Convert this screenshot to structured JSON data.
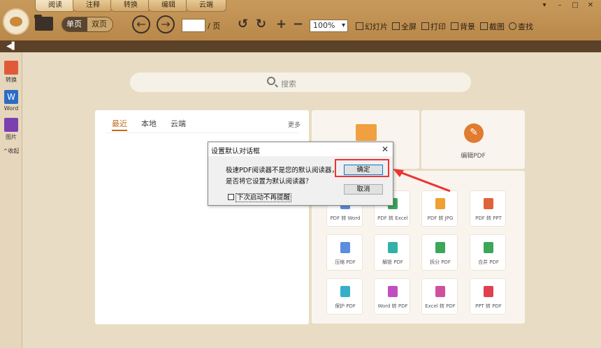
{
  "tabs": [
    "阅读",
    "注释",
    "转换",
    "编辑",
    "云端"
  ],
  "active_tab": "阅读",
  "window_controls": [
    "▾",
    "–",
    "□",
    "✕"
  ],
  "toolbar": {
    "single_page": "单页",
    "double_page": "双页",
    "page_suffix": "/ 页",
    "zoom_value": "100%",
    "slideshow": "幻灯片",
    "fullscreen": "全屏",
    "print": "打印",
    "background": "背景",
    "screenshot": "截图",
    "find": "查找"
  },
  "sidebar": {
    "items": [
      {
        "label": "转换",
        "icon": "pdf-convert-icon",
        "color": "#e05a3a"
      },
      {
        "label": "Word",
        "icon": "word-icon",
        "color": "#2b6cc4"
      },
      {
        "label": "图片",
        "icon": "image-icon",
        "color": "#7b3fb0"
      }
    ],
    "collapse_label": "收起"
  },
  "search": {
    "placeholder": "搜索"
  },
  "recent_panel": {
    "tabs": [
      "最近",
      "本地",
      "云端"
    ],
    "active": "最近",
    "more": "更多"
  },
  "cards": {
    "open_label": "",
    "edit_label": "编辑PDF"
  },
  "tools": [
    {
      "label": "PDF 转 Word",
      "color": "#5b8de0"
    },
    {
      "label": "PDF 转 Excel",
      "color": "#3ca65a"
    },
    {
      "label": "PDF 转 JPG",
      "color": "#f0a030"
    },
    {
      "label": "PDF 转 PPT",
      "color": "#e0613a"
    },
    {
      "label": "压缩 PDF",
      "color": "#5b8de0"
    },
    {
      "label": "解锁 PDF",
      "color": "#35b0a8"
    },
    {
      "label": "拆分 PDF",
      "color": "#3ca65a"
    },
    {
      "label": "合并 PDF",
      "color": "#3ca65a"
    },
    {
      "label": "保护 PDF",
      "color": "#35b0c8"
    },
    {
      "label": "Word 转 PDF",
      "color": "#c050c0"
    },
    {
      "label": "Excel 转 PDF",
      "color": "#d050a0"
    },
    {
      "label": "PPT 转 PDF",
      "color": "#e04050"
    }
  ],
  "dialog": {
    "title": "设置默认对话框",
    "message_line1": "极速PDF阅读器不是您的默认阅读器，",
    "message_line2": "是否将它设置为默认阅读器？",
    "checkbox_label": "下次启动不再提醒",
    "ok": "确定",
    "cancel": "取消",
    "close": "✕"
  },
  "annotation": {
    "highlight_color": "#e33333"
  }
}
